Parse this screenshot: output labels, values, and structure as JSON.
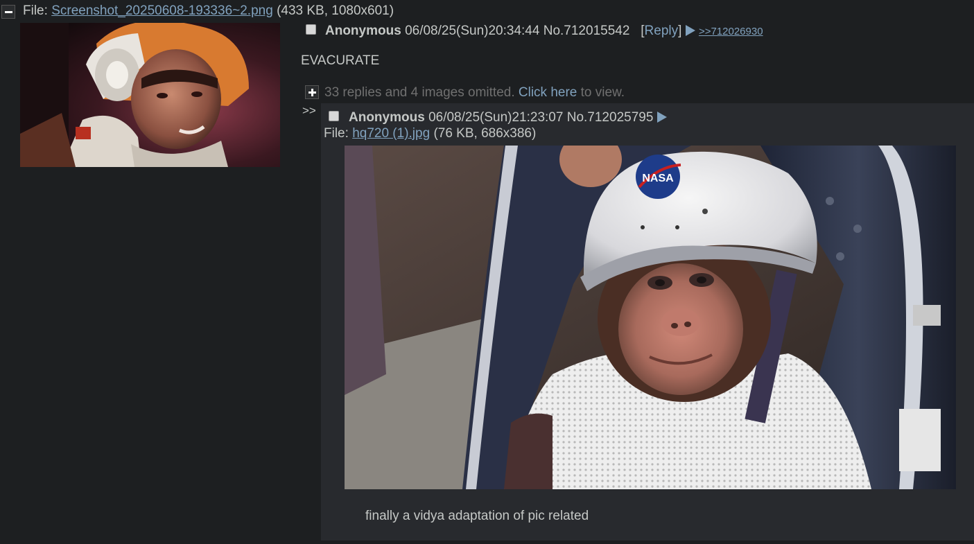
{
  "op": {
    "file_label": "File:",
    "file_name": "Screenshot_20250608-193336~2.png",
    "file_meta": "(433 KB, 1080x601)",
    "name": "Anonymous",
    "datetime": "06/08/25(Sun)20:34:44",
    "post_no": "No.712015542",
    "reply_open": "[",
    "reply_label": "Reply",
    "reply_close": "]",
    "backlink": ">>712026930",
    "comment": "EVACURATE"
  },
  "omitted": {
    "text": "33 replies and 4 images omitted.",
    "link": "Click here",
    "suffix": "to view."
  },
  "reply": {
    "side_arrows": ">>",
    "name": "Anonymous",
    "datetime": "06/08/25(Sun)21:23:07",
    "post_no": "No.712025795",
    "file_label": "File:",
    "file_name": "hq720 (1).jpg",
    "file_meta": "(76 KB, 686x386)",
    "comment": "finally a vidya adaptation of pic related"
  },
  "image_text": {
    "helmet_logo": "NASA"
  },
  "colors": {
    "background": "#1d1f21",
    "reply_background": "#282a2e",
    "text": "#c5c8c6",
    "link": "#81a2be"
  }
}
